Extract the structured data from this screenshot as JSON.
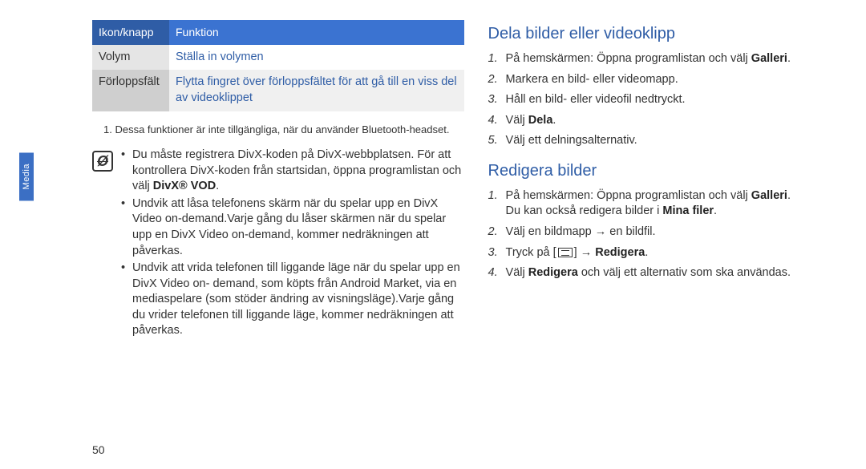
{
  "rail": {
    "label": "Media"
  },
  "pageNumber": "50",
  "table": {
    "head": {
      "col1": "Ikon/knapp",
      "col2": "Funktion"
    },
    "rows": [
      {
        "col1": "Volym",
        "col2": "Ställa in volymen"
      },
      {
        "col1": "Förloppsfält",
        "col2": "Flytta fingret över förloppsfältet för att gå till en viss del av videoklippet"
      }
    ]
  },
  "footnote": "1. Dessa funktioner är inte tillgängliga, när du använder Bluetooth-headset.",
  "note": {
    "bullets": [
      {
        "pre": "Du måste registrera DivX-koden på DivX-webbplatsen. För att kontrollera DivX-koden från startsidan, öppna programlistan och välj ",
        "bold": "DivX® VOD",
        "post": "."
      },
      {
        "pre": "Undvik att låsa telefonens skärm när du spelar upp en DivX Video on-demand.Varje gång du låser skärmen när du spelar upp en DivX Video on-demand, kommer nedräkningen att påverkas.",
        "bold": "",
        "post": ""
      },
      {
        "pre": "Undvik att vrida telefonen till liggande läge när du spelar upp en DivX Video on- demand, som köpts från Android Market, via en mediaspelare (som stöder ändring av visningsläge).Varje gång du vrider telefonen till liggande läge, kommer nedräkningen att påverkas.",
        "bold": "",
        "post": ""
      }
    ]
  },
  "sections": {
    "share": {
      "title": "Dela bilder eller videoklipp",
      "steps": [
        {
          "n": "1.",
          "pre": "På hemskärmen: Öppna programlistan och välj ",
          "bold": "Galleri",
          "post": "."
        },
        {
          "n": "2.",
          "pre": "Markera en bild- eller videomapp.",
          "bold": "",
          "post": ""
        },
        {
          "n": "3.",
          "pre": "Håll en bild- eller videofil nedtryckt.",
          "bold": "",
          "post": ""
        },
        {
          "n": "4.",
          "pre": "Välj ",
          "bold": "Dela",
          "post": "."
        },
        {
          "n": "5.",
          "pre": "Välj ett delningsalternativ.",
          "bold": "",
          "post": ""
        }
      ]
    },
    "edit": {
      "title": "Redigera bilder",
      "steps": [
        {
          "n": "1.",
          "pre": "På hemskärmen: Öppna programlistan och välj ",
          "bold": "Galleri",
          "post": ".",
          "extraPre": "Du kan också redigera bilder i ",
          "extraBold": "Mina filer",
          "extraPost": "."
        },
        {
          "n": "2.",
          "pre": "Välj en bildmapp → en bildfil.",
          "bold": "",
          "post": ""
        },
        {
          "n": "3.",
          "pre": "Tryck på [",
          "icon": true,
          "mid": "] → ",
          "bold": "Redigera",
          "post": "."
        },
        {
          "n": "4.",
          "pre": "Välj ",
          "bold": "Redigera",
          "post": " och välj ett alternativ som ska användas."
        }
      ]
    }
  }
}
